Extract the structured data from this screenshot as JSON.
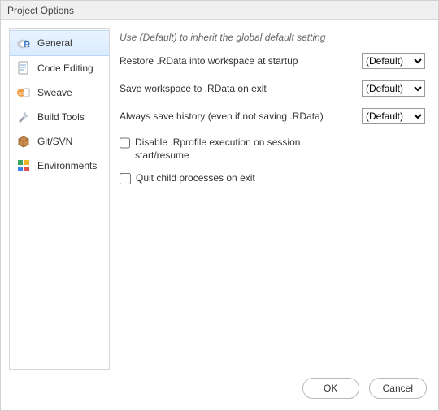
{
  "window": {
    "title": "Project Options"
  },
  "sidebar": {
    "items": [
      {
        "key": "general",
        "label": "General",
        "icon": "r-logo",
        "selected": true
      },
      {
        "key": "code-editing",
        "label": "Code Editing",
        "icon": "document"
      },
      {
        "key": "sweave",
        "label": "Sweave",
        "icon": "sweave"
      },
      {
        "key": "build-tools",
        "label": "Build Tools",
        "icon": "tools"
      },
      {
        "key": "git-svn",
        "label": "Git/SVN",
        "icon": "package"
      },
      {
        "key": "environments",
        "label": "Environments",
        "icon": "envs"
      }
    ]
  },
  "content": {
    "hint": "Use (Default) to inherit the global default setting",
    "rows": [
      {
        "key": "restore-rdata",
        "label": "Restore .RData into workspace at startup",
        "value": "(Default)"
      },
      {
        "key": "save-workspace",
        "label": "Save workspace to .RData on exit",
        "value": "(Default)"
      },
      {
        "key": "save-history",
        "label": "Always save history (even if not saving .RData)",
        "value": "(Default)"
      }
    ],
    "checks": [
      {
        "key": "disable-rprofile",
        "label": "Disable .Rprofile execution on session start/resume",
        "checked": false
      },
      {
        "key": "quit-child",
        "label": "Quit child processes on exit",
        "checked": false
      }
    ],
    "select_options": [
      "(Default)"
    ]
  },
  "footer": {
    "ok": "OK",
    "cancel": "Cancel"
  }
}
